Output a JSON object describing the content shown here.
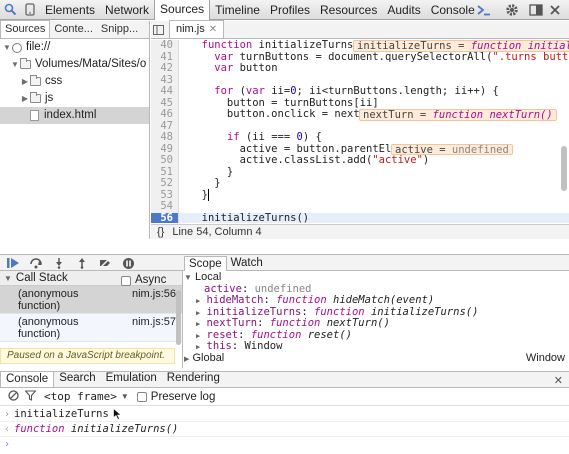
{
  "toolbar": {
    "tabs": [
      "Elements",
      "Network",
      "Sources",
      "Timeline",
      "Profiles",
      "Resources",
      "Audits",
      "Console"
    ],
    "selected_tab": "Sources"
  },
  "navigator": {
    "tabs": [
      "Sources",
      "Conte...",
      "Snipp..."
    ],
    "tree": [
      {
        "label": "file://",
        "level": 0,
        "kind": "origin",
        "expanded": true
      },
      {
        "label": "Volumes/Mata/Sites/o",
        "level": 1,
        "kind": "folder",
        "expanded": true
      },
      {
        "label": "css",
        "level": 2,
        "kind": "folder",
        "expanded": false
      },
      {
        "label": "js",
        "level": 2,
        "kind": "folder",
        "expanded": false
      },
      {
        "label": "index.html",
        "level": 2,
        "kind": "file",
        "selected": true
      }
    ]
  },
  "editor": {
    "file_tab": "nim.js",
    "status": "Line 54, Column 4",
    "status_icon": "{}",
    "exec_line": "56"
  },
  "callstack": {
    "title": "Call Stack",
    "async_label": "Async",
    "frames": [
      {
        "name_line1": "(anonymous",
        "name_line2": "function)",
        "location": "nim.js:56"
      },
      {
        "name_line1": "(anonymous",
        "name_line2": "function)",
        "location": "nim.js:57"
      }
    ],
    "paused_message": "Paused on a JavaScript breakpoint."
  },
  "scope": {
    "tabs": [
      "Scope",
      "Watch"
    ],
    "local_label": "Local",
    "global_label": "Global",
    "global_value": "Window"
  },
  "drawer": {
    "tabs": [
      "Console",
      "Search",
      "Emulation",
      "Rendering"
    ],
    "frame_select": "<top frame>",
    "preserve_log": "Preserve log",
    "lines": [
      {
        "kind": "input",
        "text": "initializeTurns"
      },
      {
        "kind": "result",
        "keyword": "function",
        "rest": " initializeTurns()"
      }
    ]
  }
}
